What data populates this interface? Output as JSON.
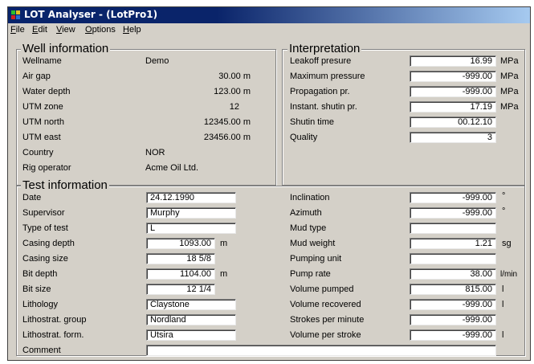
{
  "window": {
    "title": "LOT Analyser - (LotPro1)"
  },
  "menu": [
    {
      "pre": "",
      "u": "F",
      "post": "ile"
    },
    {
      "pre": "",
      "u": "E",
      "post": "dit"
    },
    {
      "pre": "",
      "u": "V",
      "post": "iew"
    },
    {
      "pre": "",
      "u": "O",
      "post": "ptions"
    },
    {
      "pre": "",
      "u": "H",
      "post": "elp"
    }
  ],
  "well": {
    "title": "Well information",
    "rows": [
      {
        "label": "Wellname",
        "value": "Demo"
      },
      {
        "label": "Air gap",
        "value": "30.00 m"
      },
      {
        "label": "Water depth",
        "value": "123.00 m"
      },
      {
        "label": "UTM zone",
        "value": "12"
      },
      {
        "label": "UTM north",
        "value": "12345.00 m"
      },
      {
        "label": "UTM east",
        "value": "23456.00 m"
      },
      {
        "label": "Country",
        "value": "NOR"
      },
      {
        "label": "Rig operator",
        "value": "Acme Oil Ltd."
      }
    ]
  },
  "interp": {
    "title": "Interpretation",
    "rows": [
      {
        "label": "Leakoff presure",
        "value": "16.99",
        "unit": "MPa"
      },
      {
        "label": "Maximum pressure",
        "value": "-999.00",
        "unit": "MPa"
      },
      {
        "label": "Propagation pr.",
        "value": "-999.00",
        "unit": "MPa"
      },
      {
        "label": "Instant. shutin pr.",
        "value": "17.19",
        "unit": "MPa"
      },
      {
        "label": "Shutin time",
        "value": "00.12.10",
        "unit": ""
      },
      {
        "label": "Quality",
        "value": "3",
        "unit": ""
      }
    ]
  },
  "test": {
    "title": "Test information",
    "left": [
      {
        "label": "Date",
        "value": "24.12.1990",
        "unit": ""
      },
      {
        "label": "Supervisor",
        "value": "Murphy",
        "unit": ""
      },
      {
        "label": "Type of test",
        "value": "L",
        "unit": ""
      },
      {
        "label": "Casing depth",
        "value": "1093.00",
        "unit": "m"
      },
      {
        "label": "Casing size",
        "value": "18 5/8",
        "unit": ""
      },
      {
        "label": "Bit depth",
        "value": "1104.00",
        "unit": "m"
      },
      {
        "label": "Bit size",
        "value": "12 1/4",
        "unit": ""
      },
      {
        "label": "Lithology",
        "value": "Claystone",
        "unit": ""
      },
      {
        "label": "Lithostrat. group",
        "value": "Nordland",
        "unit": ""
      },
      {
        "label": "Lithostrat. form.",
        "value": "Utsira",
        "unit": ""
      }
    ],
    "right": [
      {
        "label": "Inclination",
        "value": "-999.00",
        "unit": "°"
      },
      {
        "label": "Azimuth",
        "value": "-999.00",
        "unit": "°"
      },
      {
        "label": "Mud type",
        "value": "",
        "unit": ""
      },
      {
        "label": "Mud weight",
        "value": "1.21",
        "unit": "sg"
      },
      {
        "label": "Pumping unit",
        "value": "",
        "unit": ""
      },
      {
        "label": "Pump rate",
        "value": "38.00",
        "unit": "l/min"
      },
      {
        "label": "Volume pumped",
        "value": "815.00",
        "unit": "l"
      },
      {
        "label": "Volume recovered",
        "value": "-999.00",
        "unit": "l"
      },
      {
        "label": "Strokes per minute",
        "value": "-999.00",
        "unit": ""
      },
      {
        "label": "Volume per stroke",
        "value": "-999.00",
        "unit": "l"
      }
    ],
    "comment_label": "Comment",
    "comment_value": ""
  }
}
